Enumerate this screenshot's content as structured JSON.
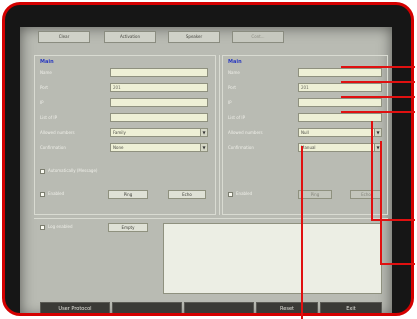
{
  "tabs": [
    {
      "label": "Clear"
    },
    {
      "label": "Activation"
    },
    {
      "label": "Speaker"
    },
    {
      "label": "Cont..."
    }
  ],
  "left_panel": {
    "title": "Main",
    "fields": [
      {
        "label": "Name",
        "value": ""
      },
      {
        "label": "Port",
        "value": "201"
      },
      {
        "label": "IP",
        "value": ""
      },
      {
        "label": "List of IP",
        "value": ""
      }
    ],
    "selects": [
      {
        "label": "Allowed numbers",
        "value": "Family"
      },
      {
        "label": "Confirmation",
        "value": "None"
      }
    ],
    "checkbox_label": "Automatically (Message)",
    "enabled_label": "Enabled",
    "ping_label": "Ping",
    "echo_label": "Echo"
  },
  "right_panel": {
    "title": "Main",
    "fields": [
      {
        "label": "Name",
        "value": ""
      },
      {
        "label": "Port",
        "value": "201"
      },
      {
        "label": "IP",
        "value": ""
      },
      {
        "label": "List of IP",
        "value": ""
      }
    ],
    "selects": [
      {
        "label": "Allowed numbers",
        "value": "Null"
      },
      {
        "label": "Confirmation",
        "value": "Manual"
      }
    ],
    "enabled_label": "Enabled",
    "ping_label": "Ping",
    "echo_label": "Echo"
  },
  "log": {
    "checkbox_label": "Log enabled",
    "button_label": "Empty"
  },
  "bottom_bar": [
    {
      "label": "User Protocol"
    },
    {
      "label": ""
    },
    {
      "label": ""
    },
    {
      "label": "Reset"
    },
    {
      "label": "Exit"
    }
  ],
  "colors": {
    "bezel": "#161616",
    "outline": "#d40000",
    "screen": "#b9bbb3",
    "field_bg": "#eef0d6",
    "callout": "#e01010"
  }
}
